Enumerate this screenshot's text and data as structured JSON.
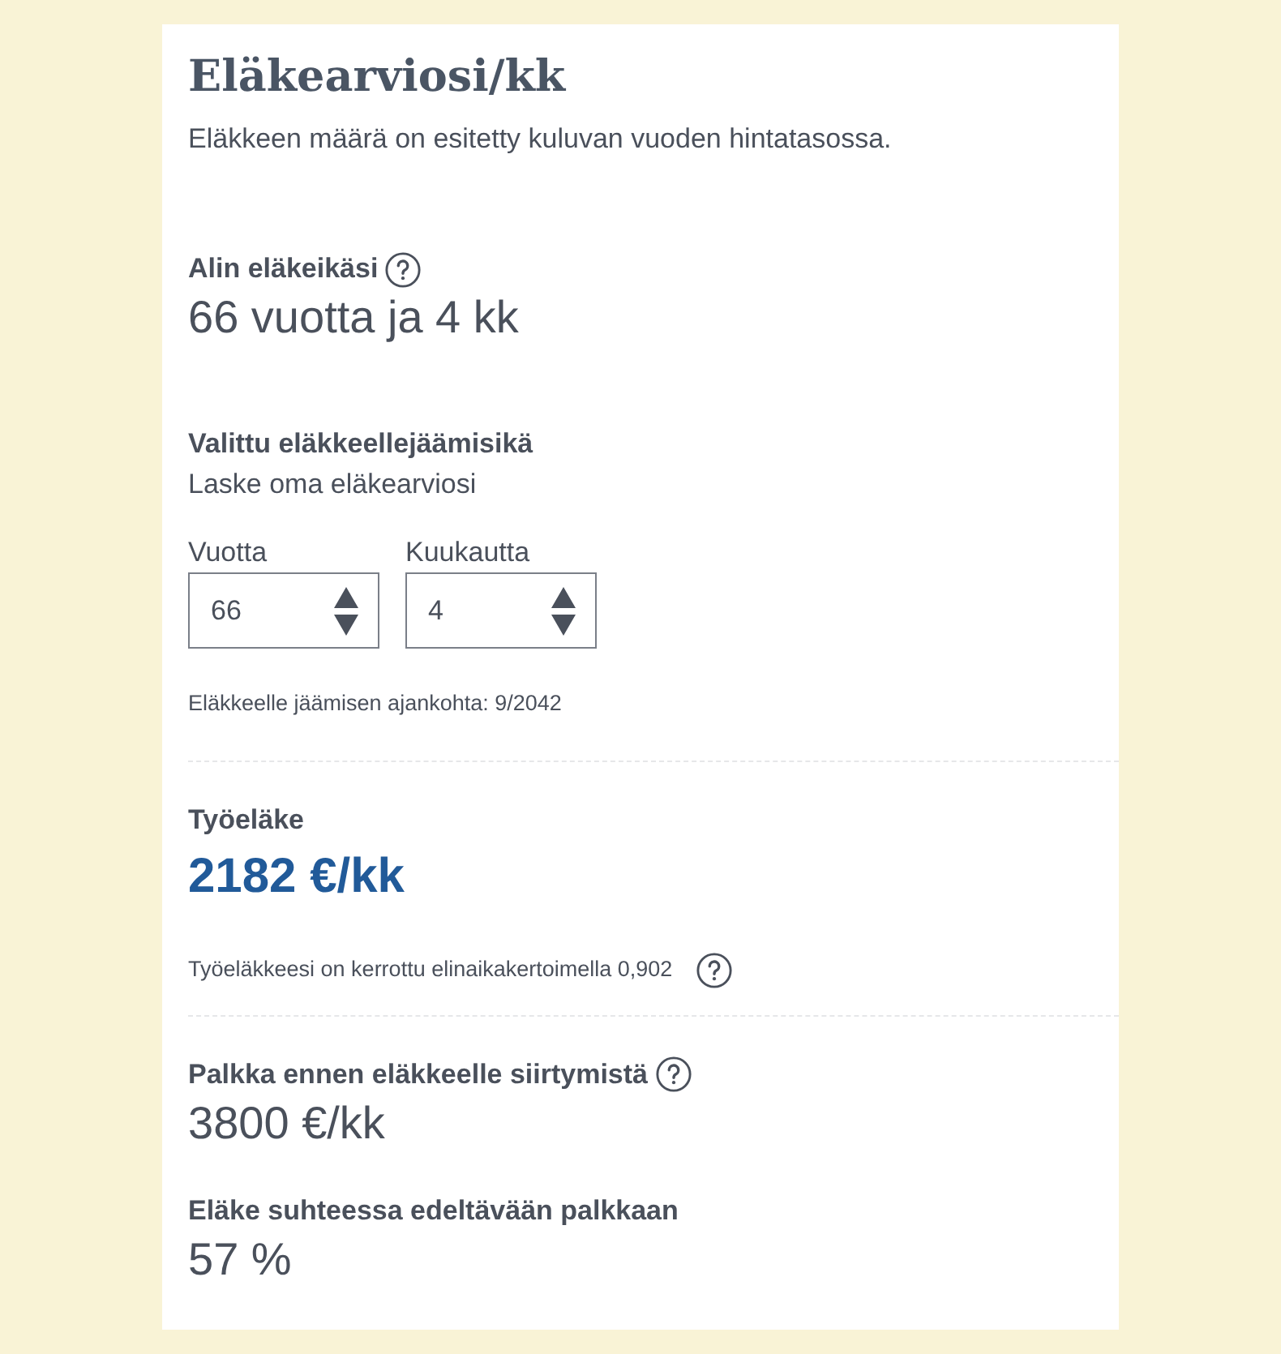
{
  "title": "Eläkearviosi/kk",
  "subtitle": "Eläkkeen määrä on esitetty kuluvan vuoden hintatasossa.",
  "minimum_age": {
    "label": "Alin eläkeikäsi",
    "help_icon": true,
    "value": "66 vuotta ja 4 kk"
  },
  "chosen_age": {
    "label": "Valittu eläkkeellejäämisikä",
    "hint": "Laske oma eläkearviosi",
    "fields": [
      {
        "label": "Vuotta",
        "value": "66"
      },
      {
        "label": "Kuukautta",
        "value": "4"
      }
    ],
    "note": "Eläkkeelle jäämisen ajankohta: 9/2042"
  },
  "earnings_pension": {
    "label": "Työeläke",
    "value": "2182 €/kk",
    "note": "Työeläkkeesi on kerrottu elinaikakertoimella 0,902",
    "note_help_icon": true
  },
  "results": [
    {
      "label": "Palkka ennen eläkkeelle siirtymistä",
      "help_icon": true,
      "value": "3800 €/kk"
    },
    {
      "label": "Eläke suhteessa edeltävään palkkaan",
      "help_icon": false,
      "value": "57 %"
    }
  ]
}
